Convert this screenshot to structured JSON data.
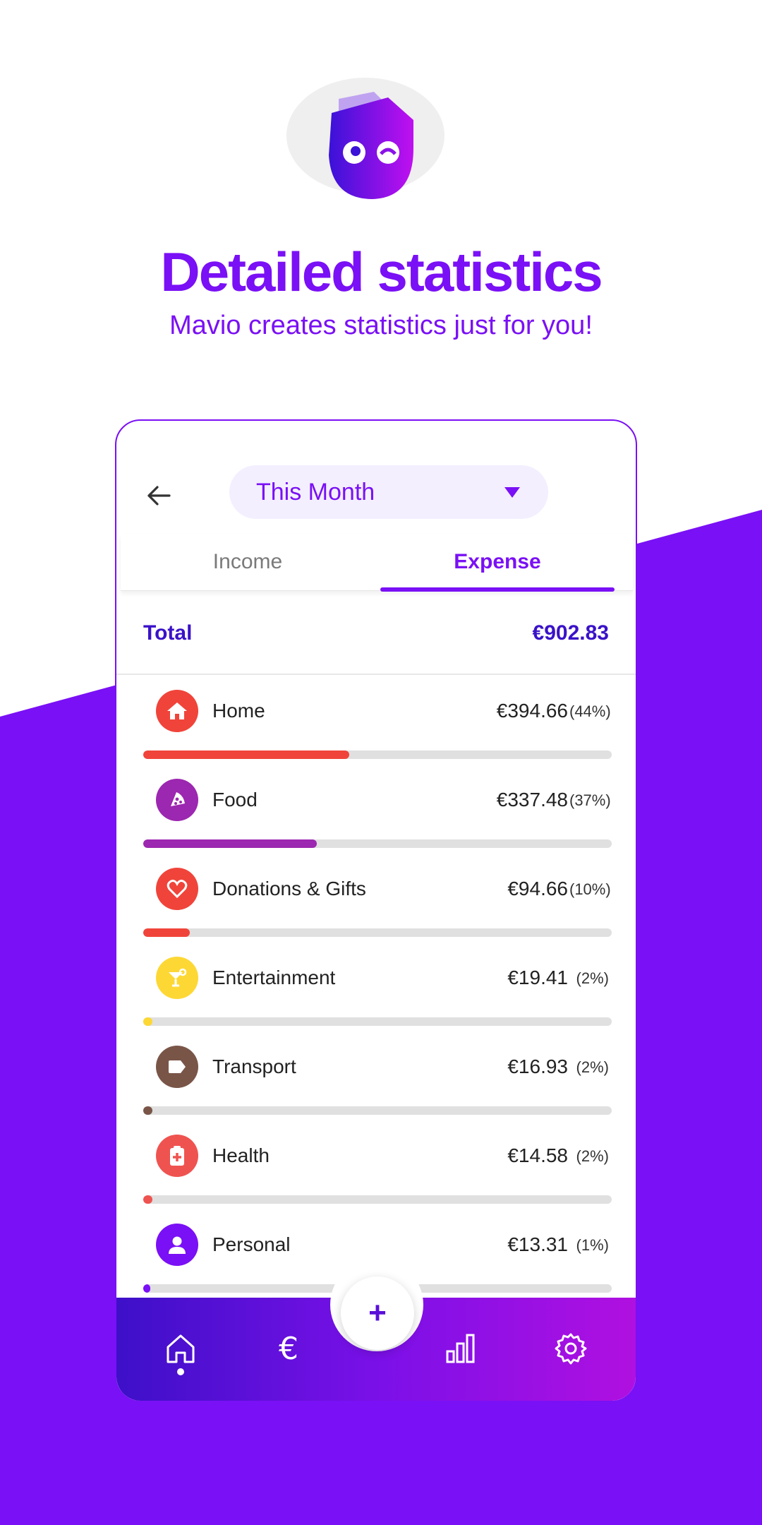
{
  "colors": {
    "brand": "#7a10f5",
    "total_text": "#3a12c8",
    "home": "#f0443a",
    "food": "#9c27b0",
    "donations": "#f0443a",
    "entertainment": "#fdd835",
    "transport": "#795548",
    "health": "#ef5350",
    "personal": "#7a10f5"
  },
  "hero": {
    "title": "Detailed statistics",
    "subtitle": "Mavio creates statistics just for you!",
    "logo_icon": "mavio-mascot-icon"
  },
  "header": {
    "back_icon": "arrow-left-icon",
    "period_value": "This Month",
    "period_icon": "caret-down-icon"
  },
  "tabs": [
    {
      "label": "Income",
      "active": false
    },
    {
      "label": "Expense",
      "active": true
    }
  ],
  "total": {
    "label": "Total",
    "value": "€902.83"
  },
  "categories": [
    {
      "name": "Home",
      "amount": "€394.66",
      "percent": "(44%)",
      "share": 0.44,
      "icon": "house-icon"
    },
    {
      "name": "Food",
      "amount": "€337.48",
      "percent": "(37%)",
      "share": 0.37,
      "icon": "pizza-icon"
    },
    {
      "name": "Donations & Gifts",
      "amount": "€94.66",
      "percent": "(10%)",
      "share": 0.1,
      "icon": "heart-icon"
    },
    {
      "name": "Entertainment",
      "amount": "€19.41",
      "percent": "(2%)",
      "share": 0.02,
      "icon": "cocktail-icon"
    },
    {
      "name": "Transport",
      "amount": "€16.93",
      "percent": "(2%)",
      "share": 0.02,
      "icon": "tag-icon"
    },
    {
      "name": "Health",
      "amount": "€14.58",
      "percent": "(2%)",
      "share": 0.02,
      "icon": "clipboard-plus-icon"
    },
    {
      "name": "Personal",
      "amount": "€13.31",
      "percent": "(1%)",
      "share": 0.01,
      "icon": "person-icon"
    }
  ],
  "bottom_nav": {
    "items": [
      "home-icon",
      "euro-icon",
      "bar-chart-icon",
      "gear-icon"
    ],
    "active": "home-icon",
    "fab_label": "+"
  }
}
